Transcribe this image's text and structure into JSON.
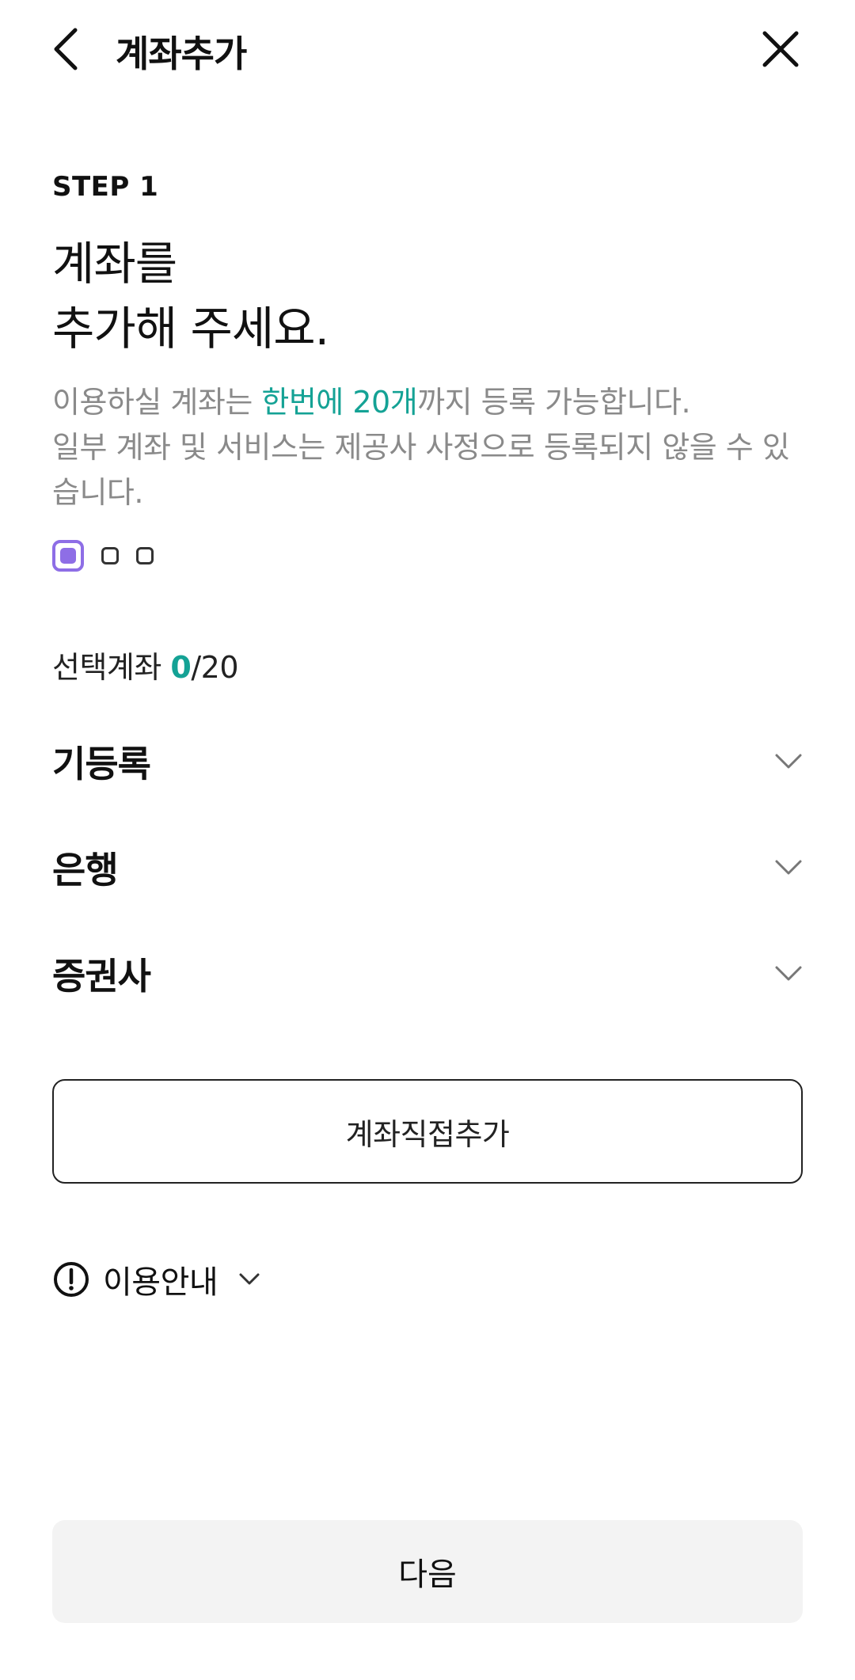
{
  "header": {
    "title": "계좌추가",
    "back_icon": "chevron-left-icon",
    "close_icon": "close-icon"
  },
  "intro": {
    "step_label": "STEP 1",
    "headline_line1": "계좌를",
    "headline_line2": "추가해 주세요.",
    "desc_part1": "이용하실 계좌는 ",
    "desc_highlight": "한번에 20개",
    "desc_part2": "까지 등록 가능합니다.",
    "desc_line2": "일부 계좌 및 서비스는 제공사 사정으로 등록되지 않을 수 있습니다."
  },
  "pager": {
    "total": 3,
    "active_index": 0
  },
  "selection": {
    "label": "선택계좌 ",
    "count": "0",
    "max": "/20"
  },
  "sections": [
    {
      "title": "기등록",
      "icon": "chevron-down-icon"
    },
    {
      "title": "은행",
      "icon": "chevron-down-icon"
    },
    {
      "title": "증권사",
      "icon": "chevron-down-icon"
    }
  ],
  "direct_add": {
    "label": "계좌직접추가"
  },
  "guide": {
    "label": "이용안내",
    "icon": "info-circle-icon",
    "chevron_icon": "chevron-down-icon"
  },
  "footer": {
    "next_label": "다음"
  },
  "colors": {
    "accent_teal": "#14a295",
    "pager_purple": "#8e6ee6",
    "muted_text": "#8a8a8a",
    "next_bg": "#f3f3f3"
  }
}
